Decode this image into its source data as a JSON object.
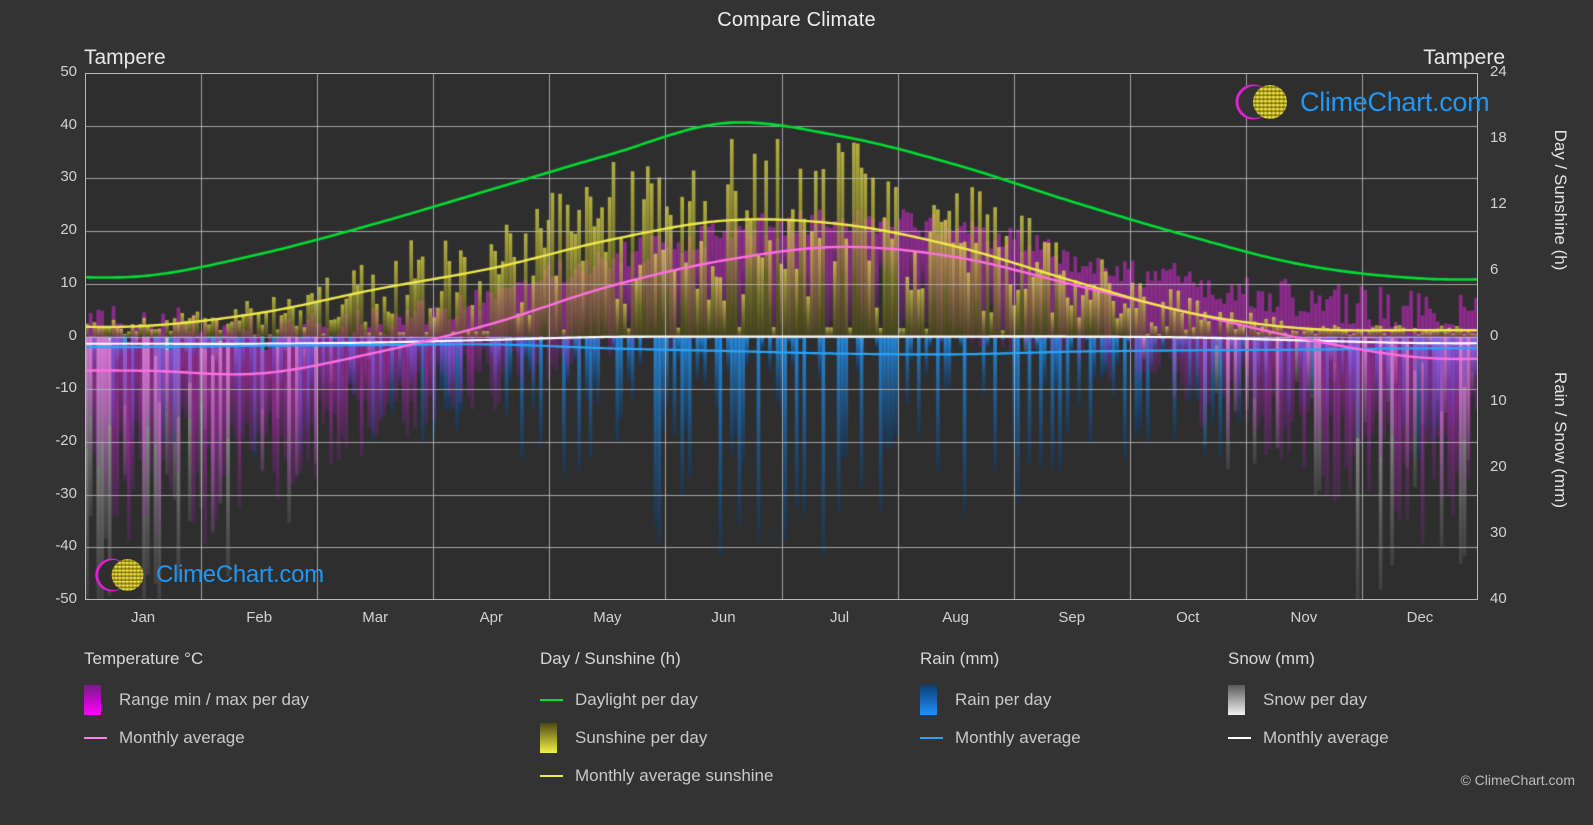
{
  "header": {
    "title": "Compare Climate",
    "city_left": "Tampere",
    "city_right": "Tampere"
  },
  "axes": {
    "left_title": "Temperature °C",
    "right_title_top": "Day / Sunshine (h)",
    "right_title_bottom": "Rain / Snow (mm)",
    "left_ticks": [
      "50",
      "40",
      "30",
      "20",
      "10",
      "0",
      "-10",
      "-20",
      "-30",
      "-40",
      "-50"
    ],
    "right_top_ticks": [
      "24",
      "18",
      "12",
      "6",
      "0"
    ],
    "right_bottom_ticks": [
      "0",
      "10",
      "20",
      "30",
      "40"
    ],
    "x_ticks": [
      "Jan",
      "Feb",
      "Mar",
      "Apr",
      "May",
      "Jun",
      "Jul",
      "Aug",
      "Sep",
      "Oct",
      "Nov",
      "Dec"
    ]
  },
  "legend": {
    "groups": [
      {
        "title": "Temperature °C",
        "items": [
          {
            "label": "Range min / max per day",
            "marker": "gradient-box",
            "color": "#ff00ff",
            "color2": "#7a1a8a"
          },
          {
            "label": "Monthly average",
            "marker": "line",
            "color": "#ff7fe0"
          }
        ]
      },
      {
        "title": "Day / Sunshine (h)",
        "items": [
          {
            "label": "Daylight per day",
            "marker": "line",
            "color": "#00dd33"
          },
          {
            "label": "Sunshine per day",
            "marker": "gradient-box",
            "color": "#f5f04a",
            "color2": "#4d4a10"
          },
          {
            "label": "Monthly average sunshine",
            "marker": "line",
            "color": "#efe94a"
          }
        ]
      },
      {
        "title": "Rain (mm)",
        "items": [
          {
            "label": "Rain per day",
            "marker": "gradient-box",
            "color": "#1e90ff",
            "color2": "#0b3f70"
          },
          {
            "label": "Monthly average",
            "marker": "line",
            "color": "#29a3f5"
          }
        ]
      },
      {
        "title": "Snow (mm)",
        "items": [
          {
            "label": "Snow per day",
            "marker": "gradient-box",
            "color": "#f2f2f2",
            "color2": "#5a5a5a"
          },
          {
            "label": "Monthly average",
            "marker": "line",
            "color": "#ffffff"
          }
        ]
      }
    ]
  },
  "branding": {
    "watermark_text": "ClimeChart.com",
    "copyright": "© ClimeChart.com"
  },
  "colors": {
    "background": "#333333",
    "plot_background": "#2e2e2e",
    "grid": "#9a9a9a",
    "text": "#d2d2d2",
    "daylight": "#00dd33",
    "sunshine_avg": "#efe94a",
    "sunshine_bar": "#c8c23c",
    "temp_avg": "#ff6fe0",
    "temp_range": "#d626d6",
    "rain_avg": "#2aa5f7",
    "rain_bar": "#1e78c8",
    "snow_avg": "#ffffff",
    "snow_bar": "#8d8d8d",
    "logo_blue": "#2196f3",
    "logo_magenta": "#e020d0",
    "logo_yellow": "#d9cc1e"
  },
  "chart_data": {
    "type": "line",
    "title": "Compare Climate",
    "subtitle": "Tampere",
    "xlabel": "",
    "ylabel": "Temperature °C",
    "ylim": [
      -50,
      50
    ],
    "y2lim_top": [
      0,
      24
    ],
    "y2lim_bottom": [
      0,
      40
    ],
    "grid": true,
    "legend_position": "bottom",
    "categories": [
      "Jan",
      "Feb",
      "Mar",
      "Apr",
      "May",
      "Jun",
      "Jul",
      "Aug",
      "Sep",
      "Oct",
      "Nov",
      "Dec"
    ],
    "series": [
      {
        "name": "Daylight per day",
        "unit": "h",
        "axis": "right-top",
        "color": "#00dd33",
        "values": [
          6.0,
          8.1,
          11.0,
          14.2,
          17.3,
          19.5,
          18.5,
          15.7,
          12.6,
          9.5,
          6.8,
          5.5
        ],
        "values_temp_scale": [
          11.5,
          15.7,
          21.5,
          28.0,
          34.5,
          40.5,
          38.0,
          32.5,
          25.5,
          19.0,
          13.5,
          11.0
        ]
      },
      {
        "name": "Monthly average sunshine",
        "unit": "h",
        "axis": "right-top",
        "color": "#efe94a",
        "values": [
          1.0,
          2.2,
          4.3,
          6.3,
          8.8,
          10.5,
          10.2,
          8.2,
          5.0,
          2.2,
          0.8,
          0.6
        ],
        "values_temp_scale": [
          2.0,
          4.5,
          9.0,
          13.0,
          18.3,
          22.0,
          21.3,
          17.0,
          10.5,
          4.5,
          1.5,
          1.2
        ]
      },
      {
        "name": "Monthly average temperature",
        "unit": "°C",
        "axis": "left",
        "color": "#ff6fe0",
        "values": [
          -6.5,
          -7.0,
          -3.0,
          2.5,
          9.5,
          14.5,
          17.0,
          15.0,
          9.8,
          4.5,
          -0.5,
          -4.0
        ]
      },
      {
        "name": "Rain monthly average",
        "unit": "mm",
        "axis": "right-bottom",
        "color": "#2aa5f7",
        "values": [
          1.6,
          1.4,
          1.3,
          1.2,
          1.8,
          2.2,
          2.6,
          2.7,
          2.3,
          2.1,
          2.0,
          1.8
        ]
      },
      {
        "name": "Snow monthly average",
        "unit": "mm",
        "axis": "right-bottom",
        "color": "#ffffff",
        "values": [
          1.1,
          1.1,
          0.9,
          0.5,
          0.05,
          0.0,
          0.0,
          0.0,
          0.0,
          0.15,
          0.6,
          1.0
        ]
      }
    ],
    "daily_bands": [
      {
        "name": "Range min / max per day",
        "color": "#d626d6",
        "axis": "left",
        "note": "daily min/max temperature bars spanning roughly -45 °C to +35 °C"
      },
      {
        "name": "Sunshine per day",
        "color": "#c8c23c",
        "axis": "right-top",
        "note": "daily sunshine hours bars, peak ~16 h in June"
      },
      {
        "name": "Rain per day",
        "color": "#1e78c8",
        "axis": "right-bottom",
        "note": "daily rain bars, up to ~35 mm"
      },
      {
        "name": "Snow per day",
        "color": "#8d8d8d",
        "axis": "right-bottom",
        "note": "daily snow bars, up to ~40 mm in winter"
      }
    ]
  }
}
